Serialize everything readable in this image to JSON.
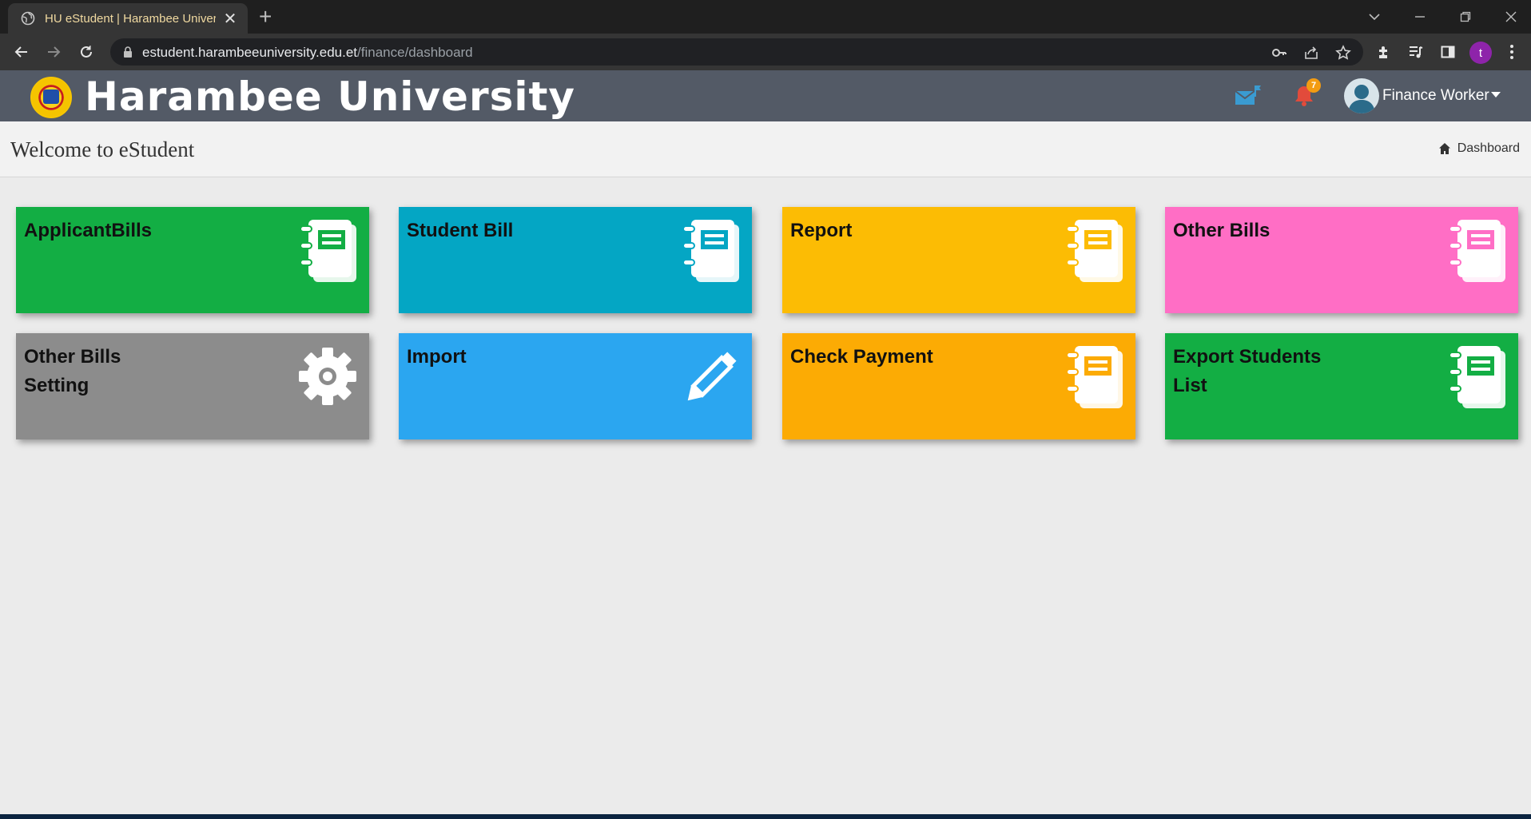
{
  "browser": {
    "tab_title": "HU eStudent | Harambee University",
    "tab_close": "✕",
    "new_tab": "+",
    "url_host": "estudent.harambeeuniversity.edu.et",
    "url_path": "/finance/dashboard",
    "profile_initial": "t"
  },
  "header": {
    "brand": "Harambee University",
    "notification_count": "7",
    "user_name": "Finance Worker"
  },
  "page": {
    "title": "Welcome to eStudent",
    "breadcrumb": "Dashboard"
  },
  "tiles": [
    {
      "label": "ApplicantBills",
      "icon": "notebook-icon",
      "color": "#13ae44"
    },
    {
      "label": "Student Bill",
      "icon": "notebook-icon",
      "color": "#04a6c4"
    },
    {
      "label": "Report",
      "icon": "notebook-icon",
      "color": "#fcbc04"
    },
    {
      "label": "Other Bills",
      "icon": "notebook-icon",
      "color": "#ff6ec5"
    },
    {
      "label": "Other Bills Setting",
      "icon": "gear-icon",
      "color": "#8c8c8c"
    },
    {
      "label": "Import",
      "icon": "pencil-icon",
      "color": "#2ba6f0"
    },
    {
      "label": "Check Payment",
      "icon": "notebook-icon",
      "color": "#fcab04"
    },
    {
      "label": "Export Students List",
      "icon": "notebook-icon",
      "color": "#13ae44"
    }
  ]
}
